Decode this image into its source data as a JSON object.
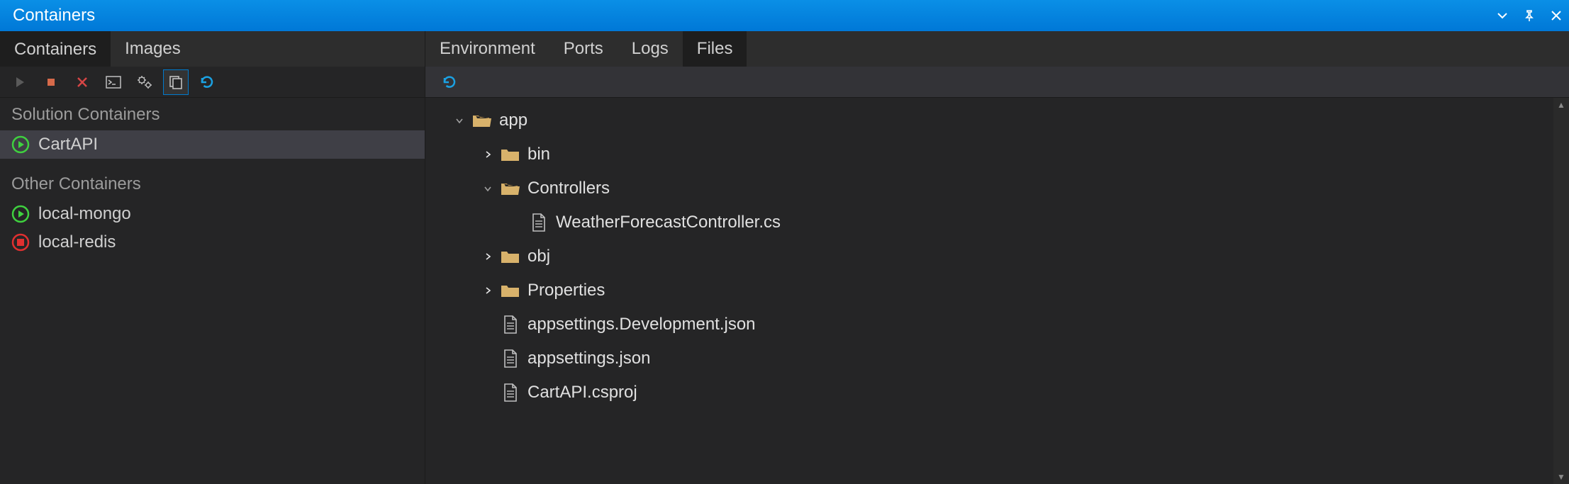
{
  "window": {
    "title": "Containers"
  },
  "left_tabs": {
    "items": [
      "Containers",
      "Images"
    ],
    "active": 0
  },
  "sections": {
    "solution": {
      "heading": "Solution Containers",
      "items": [
        {
          "name": "CartAPI",
          "status": "running",
          "selected": true
        }
      ]
    },
    "other": {
      "heading": "Other Containers",
      "items": [
        {
          "name": "local-mongo",
          "status": "running",
          "selected": false
        },
        {
          "name": "local-redis",
          "status": "stopped",
          "selected": false
        }
      ]
    }
  },
  "right_tabs": {
    "items": [
      "Environment",
      "Ports",
      "Logs",
      "Files"
    ],
    "active": 3
  },
  "tree": {
    "root": "app",
    "nodes": [
      {
        "depth": 0,
        "name": "app",
        "kind": "folder-open",
        "expander": "down"
      },
      {
        "depth": 1,
        "name": "bin",
        "kind": "folder",
        "expander": "right"
      },
      {
        "depth": 1,
        "name": "Controllers",
        "kind": "folder-open",
        "expander": "down"
      },
      {
        "depth": 2,
        "name": "WeatherForecastController.cs",
        "kind": "file",
        "expander": "none"
      },
      {
        "depth": 1,
        "name": "obj",
        "kind": "folder",
        "expander": "right"
      },
      {
        "depth": 1,
        "name": "Properties",
        "kind": "folder",
        "expander": "right"
      },
      {
        "depth": 1,
        "name": "appsettings.Development.json",
        "kind": "file",
        "expander": "none"
      },
      {
        "depth": 1,
        "name": "appsettings.json",
        "kind": "file",
        "expander": "none"
      },
      {
        "depth": 1,
        "name": "CartAPI.csproj",
        "kind": "file",
        "expander": "none"
      }
    ]
  },
  "colors": {
    "accent": "#007acc",
    "running": "#3fd13f",
    "stopped": "#e03030",
    "folder": "#d8b26b",
    "refresh": "#1ba1e2"
  }
}
